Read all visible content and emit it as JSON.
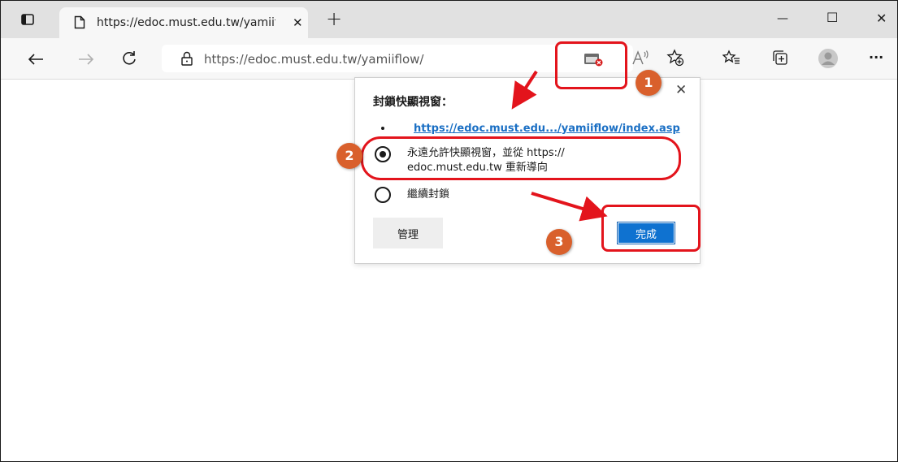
{
  "tab": {
    "title": "https://edoc.must.edu.tw/yamiifl",
    "close_glyph": "✕",
    "new_tab_glyph": "+"
  },
  "window": {
    "minimize_glyph": "—",
    "maximize_glyph": "☐",
    "close_glyph": "✕"
  },
  "toolbar": {
    "url": "https://edoc.must.edu.tw/yamiiflow/",
    "more_glyph": "···",
    "icons": [
      "back-icon",
      "forward-icon",
      "refresh-icon",
      "site-info-icon",
      "popup-blocked-icon",
      "read-aloud-icon",
      "add-favorite-icon",
      "favorites-icon",
      "collections-icon",
      "profile-icon",
      "more-icon"
    ]
  },
  "popup": {
    "title": "封鎖快顯視窗：",
    "blocked_link": "https://edoc.must.edu.../yamiiflow/index.asp",
    "option_allow_line1": "永遠允許快顯視窗，並從 https://",
    "option_allow_line2": "edoc.must.edu.tw 重新導向",
    "option_block": "繼續封鎖",
    "manage_label": "管理",
    "done_label": "完成",
    "close_glyph": "✕",
    "selected_option": "allow"
  },
  "annotations": {
    "badge1": "1",
    "badge2": "2",
    "badge3": "3",
    "highlight_color": "#e3141c",
    "badge_color": "#d9602c"
  }
}
